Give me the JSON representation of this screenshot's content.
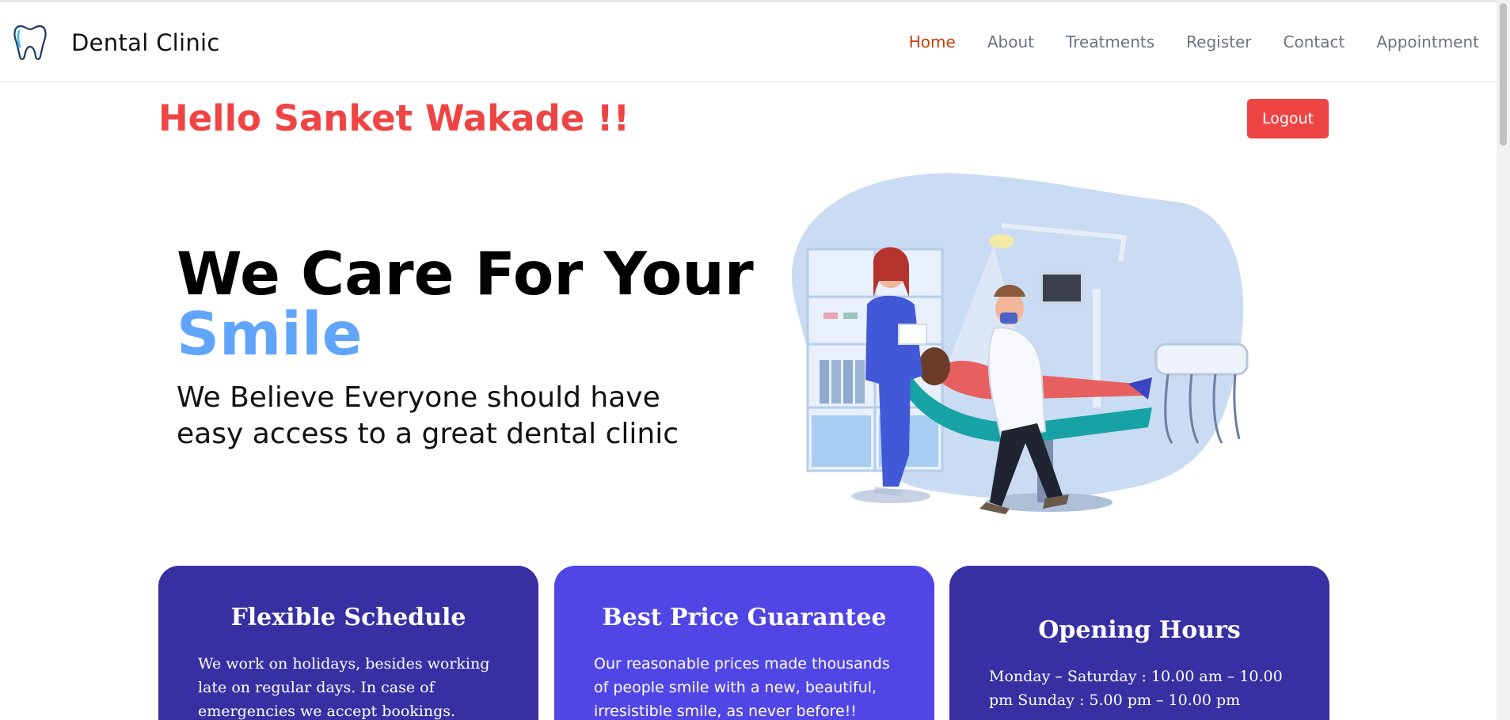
{
  "header": {
    "brand_name": "Dental Clinic",
    "nav": [
      {
        "label": "Home",
        "active": true
      },
      {
        "label": "About",
        "active": false
      },
      {
        "label": "Treatments",
        "active": false
      },
      {
        "label": "Register",
        "active": false
      },
      {
        "label": "Contact",
        "active": false
      },
      {
        "label": "Appointment",
        "active": false
      }
    ]
  },
  "greeting": "Hello Sanket Wakade !!",
  "logout_label": "Logout",
  "hero": {
    "title_line1": "We Care For Your",
    "title_accent": "Smile",
    "subtitle": "We Believe Everyone should have easy access to a great dental clinic"
  },
  "cards": [
    {
      "title": "Flexible Schedule",
      "text": "We work on holidays, besides working late on regular days. In case of emergencies we accept bookings."
    },
    {
      "title": "Best Price Guarantee",
      "text": "Our reasonable prices made thousands of people smile with a new, beautiful, irresistible smile, as never before!!"
    },
    {
      "title": "Opening Hours",
      "text": "Monday – Saturday : 10.00 am – 10.00 pm Sunday : 5.00 pm – 10.00 pm"
    }
  ],
  "colors": {
    "accent_red": "#ef4444",
    "nav_active": "#c2410c",
    "smile_blue": "#60a5fa",
    "card_dark": "#3730a3",
    "card_light": "#4f46e5"
  },
  "icons": {
    "brand": "tooth-icon",
    "hero": "dentist-illustration"
  }
}
